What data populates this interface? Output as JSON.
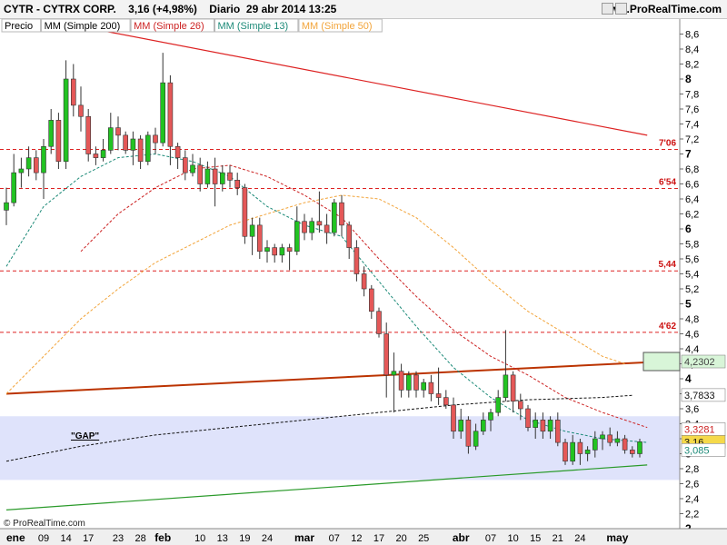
{
  "header": {
    "ticker": "CYTR - CYTRX CORP.",
    "quote": "3,16 (+4,98%)",
    "period": "Diario",
    "date": "29 abr 2014 13:25",
    "site": "www.ProRealTime.com"
  },
  "footer": {
    "copyright": "© ProRealTime.com"
  },
  "colors": {
    "up": "#22c322",
    "down": "#e45858",
    "ma200": "#111111",
    "ma26": "#cc2222",
    "ma13": "#1c8a78",
    "ma50": "#f2a43a",
    "resistance": "#dd2222",
    "support": "#2a9a2a",
    "midline": "#bb3300",
    "gap": "#dfe3fb",
    "box": "#d8f5d8"
  },
  "chart_data": {
    "type": "candlestick",
    "legend": [
      {
        "key": "price",
        "label": "Precio"
      },
      {
        "key": "ma200",
        "label": "MM (Simple 200)"
      },
      {
        "key": "ma26",
        "label": "MM (Simple 26)"
      },
      {
        "key": "ma13",
        "label": "MM (Simple 13)"
      },
      {
        "key": "ma50",
        "label": "MM (Simple 50)"
      }
    ],
    "ylim": [
      2,
      8.8
    ],
    "y_ticks": [
      "8,6",
      "8,4",
      "8,2",
      "8",
      "7,8",
      "7,6",
      "7,4",
      "7,2",
      "7",
      "6,8",
      "6,6",
      "6,4",
      "6,2",
      "6",
      "5,8",
      "5,6",
      "5,4",
      "5,2",
      "5",
      "4,8",
      "4,6",
      "4,4",
      "4,2",
      "4",
      "3,8",
      "3,6",
      "3,4",
      "3,2",
      "3",
      "2,8",
      "2,6",
      "2,4",
      "2,2",
      "2"
    ],
    "x_labels": [
      {
        "label": "ene",
        "i": 0
      },
      {
        "label": "09",
        "i": 5
      },
      {
        "label": "14",
        "i": 8
      },
      {
        "label": "17",
        "i": 11
      },
      {
        "label": "23",
        "i": 15
      },
      {
        "label": "28",
        "i": 18
      },
      {
        "label": "feb",
        "i": 21
      },
      {
        "label": "10",
        "i": 26
      },
      {
        "label": "13",
        "i": 29
      },
      {
        "label": "19",
        "i": 32
      },
      {
        "label": "24",
        "i": 35
      },
      {
        "label": "mar",
        "i": 40
      },
      {
        "label": "07",
        "i": 44
      },
      {
        "label": "12",
        "i": 47
      },
      {
        "label": "17",
        "i": 50
      },
      {
        "label": "20",
        "i": 53
      },
      {
        "label": "25",
        "i": 56
      },
      {
        "label": "abr",
        "i": 61
      },
      {
        "label": "07",
        "i": 65
      },
      {
        "label": "10",
        "i": 68
      },
      {
        "label": "15",
        "i": 71
      },
      {
        "label": "21",
        "i": 74
      },
      {
        "label": "24",
        "i": 77
      },
      {
        "label": "may",
        "i": 82
      }
    ],
    "candles": [
      [
        6.25,
        6.55,
        6.05,
        6.35
      ],
      [
        6.35,
        7.0,
        6.3,
        6.75
      ],
      [
        6.75,
        6.95,
        6.55,
        6.8
      ],
      [
        6.8,
        7.1,
        6.7,
        6.95
      ],
      [
        6.95,
        7.05,
        6.65,
        6.75
      ],
      [
        6.75,
        7.2,
        6.4,
        7.1
      ],
      [
        7.1,
        7.6,
        7.0,
        7.45
      ],
      [
        7.45,
        7.55,
        6.8,
        6.9
      ],
      [
        6.9,
        8.25,
        6.8,
        8.0
      ],
      [
        8.0,
        8.2,
        7.5,
        7.65
      ],
      [
        7.65,
        7.9,
        7.3,
        7.5
      ],
      [
        7.5,
        7.6,
        6.9,
        7.0
      ],
      [
        7.0,
        7.1,
        6.85,
        6.95
      ],
      [
        6.95,
        7.2,
        6.9,
        7.05
      ],
      [
        7.05,
        7.55,
        7.0,
        7.35
      ],
      [
        7.35,
        7.5,
        7.05,
        7.25
      ],
      [
        7.25,
        7.3,
        7.0,
        7.05
      ],
      [
        7.05,
        7.3,
        6.85,
        7.2
      ],
      [
        7.2,
        7.25,
        6.8,
        6.9
      ],
      [
        6.9,
        7.3,
        6.85,
        7.25
      ],
      [
        7.25,
        7.35,
        7.0,
        7.15
      ],
      [
        7.15,
        8.35,
        7.1,
        7.95
      ],
      [
        7.95,
        8.05,
        6.85,
        7.1
      ],
      [
        7.1,
        7.15,
        6.8,
        6.95
      ],
      [
        6.95,
        7.05,
        6.65,
        6.75
      ],
      [
        6.75,
        7.0,
        6.7,
        6.85
      ],
      [
        6.85,
        6.95,
        6.5,
        6.6
      ],
      [
        6.6,
        6.9,
        6.55,
        6.8
      ],
      [
        6.8,
        6.95,
        6.3,
        6.6
      ],
      [
        6.6,
        6.85,
        6.5,
        6.75
      ],
      [
        6.75,
        6.85,
        6.55,
        6.65
      ],
      [
        6.65,
        6.75,
        6.45,
        6.55
      ],
      [
        6.55,
        6.6,
        5.8,
        5.9
      ],
      [
        5.9,
        6.15,
        5.65,
        6.05
      ],
      [
        6.05,
        6.15,
        5.6,
        5.7
      ],
      [
        5.7,
        5.85,
        5.55,
        5.75
      ],
      [
        5.75,
        5.8,
        5.55,
        5.65
      ],
      [
        5.65,
        5.8,
        5.55,
        5.75
      ],
      [
        5.75,
        5.8,
        5.45,
        5.7
      ],
      [
        5.7,
        6.3,
        5.65,
        6.1
      ],
      [
        6.1,
        6.2,
        5.85,
        5.95
      ],
      [
        5.95,
        6.15,
        5.85,
        6.1
      ],
      [
        6.1,
        6.5,
        5.95,
        6.05
      ],
      [
        6.05,
        6.2,
        5.8,
        5.95
      ],
      [
        5.95,
        6.4,
        5.9,
        6.35
      ],
      [
        6.35,
        6.45,
        5.9,
        6.05
      ],
      [
        6.05,
        6.1,
        5.6,
        5.75
      ],
      [
        5.75,
        5.85,
        5.3,
        5.4
      ],
      [
        5.4,
        5.5,
        5.1,
        5.2
      ],
      [
        5.2,
        5.25,
        4.8,
        4.9
      ],
      [
        4.9,
        4.95,
        4.55,
        4.6
      ],
      [
        4.6,
        4.75,
        3.75,
        4.05
      ],
      [
        4.05,
        4.35,
        3.55,
        4.1
      ],
      [
        4.1,
        4.2,
        3.75,
        3.85
      ],
      [
        3.85,
        4.1,
        3.75,
        4.05
      ],
      [
        4.05,
        4.1,
        3.75,
        3.85
      ],
      [
        3.85,
        4.0,
        3.75,
        3.95
      ],
      [
        3.95,
        4.05,
        3.7,
        3.8
      ],
      [
        3.8,
        4.15,
        3.65,
        3.75
      ],
      [
        3.75,
        3.85,
        3.6,
        3.65
      ],
      [
        3.65,
        3.75,
        3.2,
        3.3
      ],
      [
        3.3,
        3.6,
        3.2,
        3.45
      ],
      [
        3.45,
        3.5,
        3.0,
        3.1
      ],
      [
        3.1,
        3.4,
        3.05,
        3.3
      ],
      [
        3.3,
        3.55,
        3.25,
        3.45
      ],
      [
        3.45,
        3.6,
        3.3,
        3.55
      ],
      [
        3.55,
        3.85,
        3.5,
        3.75
      ],
      [
        3.75,
        4.65,
        3.7,
        4.05
      ],
      [
        4.05,
        4.1,
        3.55,
        3.7
      ],
      [
        3.7,
        3.8,
        3.45,
        3.6
      ],
      [
        3.6,
        3.65,
        3.3,
        3.35
      ],
      [
        3.35,
        3.55,
        3.2,
        3.45
      ],
      [
        3.45,
        3.55,
        3.2,
        3.3
      ],
      [
        3.3,
        3.5,
        3.2,
        3.45
      ],
      [
        3.45,
        3.55,
        3.1,
        3.15
      ],
      [
        3.15,
        3.2,
        2.85,
        2.9
      ],
      [
        2.9,
        3.25,
        2.85,
        3.15
      ],
      [
        3.15,
        3.2,
        2.85,
        3.0
      ],
      [
        3.0,
        3.1,
        2.9,
        3.05
      ],
      [
        3.05,
        3.3,
        2.95,
        3.2
      ],
      [
        3.2,
        3.3,
        3.05,
        3.25
      ],
      [
        3.25,
        3.35,
        3.1,
        3.15
      ],
      [
        3.15,
        3.3,
        3.1,
        3.2
      ],
      [
        3.2,
        3.25,
        3.0,
        3.05
      ],
      [
        3.05,
        3.1,
        2.95,
        3.0
      ],
      [
        3.0,
        3.2,
        2.95,
        3.16
      ]
    ],
    "series": [
      {
        "name": "MM (Simple 13)",
        "key": "ma13",
        "points": [
          [
            0,
            5.5
          ],
          [
            5,
            6.3
          ],
          [
            10,
            6.7
          ],
          [
            15,
            6.95
          ],
          [
            20,
            7.0
          ],
          [
            25,
            6.9
          ],
          [
            30,
            6.7
          ],
          [
            35,
            6.3
          ],
          [
            40,
            6.05
          ],
          [
            45,
            5.9
          ],
          [
            50,
            5.3
          ],
          [
            55,
            4.7
          ],
          [
            60,
            4.15
          ],
          [
            65,
            3.75
          ],
          [
            70,
            3.45
          ],
          [
            75,
            3.3
          ],
          [
            80,
            3.2
          ],
          [
            86,
            3.15
          ]
        ]
      },
      {
        "name": "MM (Simple 26)",
        "key": "ma26",
        "points": [
          [
            10,
            5.7
          ],
          [
            15,
            6.2
          ],
          [
            20,
            6.55
          ],
          [
            25,
            6.8
          ],
          [
            30,
            6.85
          ],
          [
            35,
            6.7
          ],
          [
            40,
            6.45
          ],
          [
            45,
            6.15
          ],
          [
            50,
            5.6
          ],
          [
            55,
            5.1
          ],
          [
            60,
            4.65
          ],
          [
            65,
            4.3
          ],
          [
            70,
            4.05
          ],
          [
            75,
            3.75
          ],
          [
            80,
            3.55
          ],
          [
            86,
            3.35
          ]
        ]
      },
      {
        "name": "MM (Simple 50)",
        "key": "ma50",
        "points": [
          [
            0,
            3.8
          ],
          [
            5,
            4.3
          ],
          [
            10,
            4.8
          ],
          [
            15,
            5.2
          ],
          [
            20,
            5.55
          ],
          [
            25,
            5.8
          ],
          [
            30,
            6.05
          ],
          [
            35,
            6.2
          ],
          [
            40,
            6.35
          ],
          [
            45,
            6.45
          ],
          [
            50,
            6.4
          ],
          [
            55,
            6.15
          ],
          [
            60,
            5.75
          ],
          [
            65,
            5.3
          ],
          [
            70,
            4.9
          ],
          [
            75,
            4.6
          ],
          [
            80,
            4.3
          ],
          [
            83,
            4.2
          ]
        ]
      },
      {
        "name": "MM (Simple 200)",
        "key": "ma200",
        "points": [
          [
            0,
            2.9
          ],
          [
            10,
            3.1
          ],
          [
            20,
            3.25
          ],
          [
            30,
            3.35
          ],
          [
            40,
            3.45
          ],
          [
            50,
            3.55
          ],
          [
            60,
            3.65
          ],
          [
            70,
            3.72
          ],
          [
            80,
            3.75
          ],
          [
            84,
            3.78
          ]
        ]
      }
    ],
    "horizontal_lines": [
      {
        "value": 7.06,
        "label": "7'06"
      },
      {
        "value": 6.54,
        "label": "6'54"
      },
      {
        "value": 5.44,
        "label": "5,44"
      },
      {
        "value": 4.62,
        "label": "4'62"
      }
    ],
    "trend_lines": [
      {
        "key": "resistance",
        "from": [
          10,
          8.7
        ],
        "to": [
          86,
          7.25
        ]
      },
      {
        "key": "midline",
        "from": [
          0,
          3.8
        ],
        "to": [
          86,
          4.22
        ]
      },
      {
        "key": "support",
        "from": [
          0,
          2.25
        ],
        "to": [
          86,
          2.85
        ]
      }
    ],
    "gap_zone": {
      "label": "\"GAP\"",
      "from": 2.65,
      "to": 3.5
    },
    "price_tags": [
      {
        "value": 4.2302,
        "label": "4,2302",
        "bg": "#d8f5d8",
        "fg": "#444444",
        "box": true
      },
      {
        "value": 3.7833,
        "label": "3,7833",
        "bg": "#ffffff",
        "fg": "#111111"
      },
      {
        "value": 3.3281,
        "label": "3,3281",
        "bg": "#ffffff",
        "fg": "#cc2222"
      },
      {
        "value": 3.16,
        "label": "3,16",
        "bg": "#f5d94a",
        "fg": "#111111"
      },
      {
        "value": 3.05,
        "label": "3,085",
        "bg": "#ffffff",
        "fg": "#1c8a78"
      }
    ]
  }
}
